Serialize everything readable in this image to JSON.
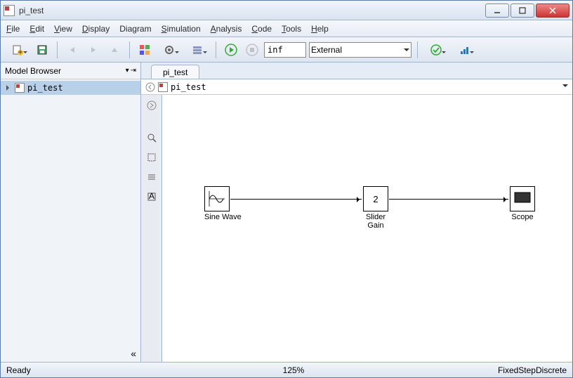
{
  "window": {
    "title": "pi_test"
  },
  "menu": {
    "file": "File",
    "edit": "Edit",
    "view": "View",
    "display": "Display",
    "diagram": "Diagram",
    "simulation": "Simulation",
    "analysis": "Analysis",
    "code": "Code",
    "tools": "Tools",
    "help": "Help"
  },
  "toolbar": {
    "stop_time": "inf",
    "sim_mode": "External"
  },
  "browser": {
    "title": "Model Browser",
    "items": [
      {
        "label": "pi_test"
      }
    ]
  },
  "tab": {
    "label": "pi_test"
  },
  "path": {
    "value": "pi_test"
  },
  "blocks": {
    "sine": {
      "label": "Sine Wave"
    },
    "gain": {
      "label": "Slider\nGain",
      "value": "2"
    },
    "scope": {
      "label": "Scope"
    }
  },
  "status": {
    "left": "Ready",
    "zoom": "125%",
    "solver": "FixedStepDiscrete"
  }
}
